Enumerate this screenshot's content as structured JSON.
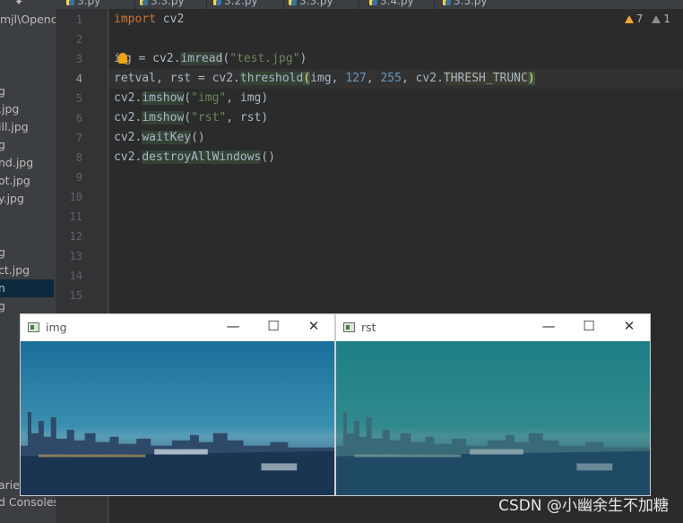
{
  "tabs": [
    {
      "label": "3.py"
    },
    {
      "label": "3.3.py"
    },
    {
      "label": "3.2.py"
    },
    {
      "label": "3.3.py"
    },
    {
      "label": "3.4.py"
    },
    {
      "label": "3.5.py"
    }
  ],
  "project": {
    "path": "mjl\\Opencv",
    "items": [
      "g",
      ".jpg",
      "ill.jpg",
      "g",
      "nd.jpg",
      "ot.jpg",
      "y.jpg",
      "g",
      "ct.jpg",
      "n",
      "g",
      "aries",
      "d Consoles"
    ]
  },
  "editor": {
    "line_numbers": [
      "1",
      "2",
      "3",
      "4",
      "5",
      "6",
      "7",
      "8",
      "9",
      "10",
      "11",
      "12",
      "13",
      "14",
      "15"
    ],
    "current_line": "4",
    "lines": {
      "l1_kw": "import",
      "l1_rest": " cv2",
      "l3_a": "i",
      "l3_b": "g = cv2.",
      "l3_fn": "imread",
      "l3_open": "(",
      "l3_str": "\"test.jpg\"",
      "l3_close": ")",
      "l4_a": "retval, rst = cv2.",
      "l4_fn": "threshold",
      "l4_open": "(",
      "l4_b": "img, ",
      "l4_n1": "127",
      "l4_c": ", ",
      "l4_n2": "255",
      "l4_d": ", cv2.",
      "l4_const": "THRESH_TRUNC",
      "l4_close": ")",
      "l5_a": "cv2.",
      "l5_fn": "imshow",
      "l5_b": "(",
      "l5_str": "\"img\"",
      "l5_c": ", img)",
      "l6_a": "cv2.",
      "l6_fn": "imshow",
      "l6_b": "(",
      "l6_str": "\"rst\"",
      "l6_c": ", rst)",
      "l7_a": "cv2.",
      "l7_fn": "waitKey",
      "l7_b": "()",
      "l8_a": "cv2.",
      "l8_fn": "destroyAllWindows",
      "l8_b": "()"
    },
    "inspections": {
      "warnings": "7",
      "weak_warnings": "1"
    }
  },
  "windows": [
    {
      "title": "img",
      "minimize": "—",
      "maximize": "☐",
      "close": "✕"
    },
    {
      "title": "rst",
      "minimize": "—",
      "maximize": "☐",
      "close": "✕"
    }
  ],
  "watermark": "CSDN @小幽余生不加糖",
  "colors": {
    "editor_bg": "#2b2b2b",
    "keyword": "#cc7832",
    "string": "#6a8759",
    "number": "#6897bb",
    "img_sky_top": "#1a6f9a",
    "rst_sky_top": "#1d7f86"
  }
}
